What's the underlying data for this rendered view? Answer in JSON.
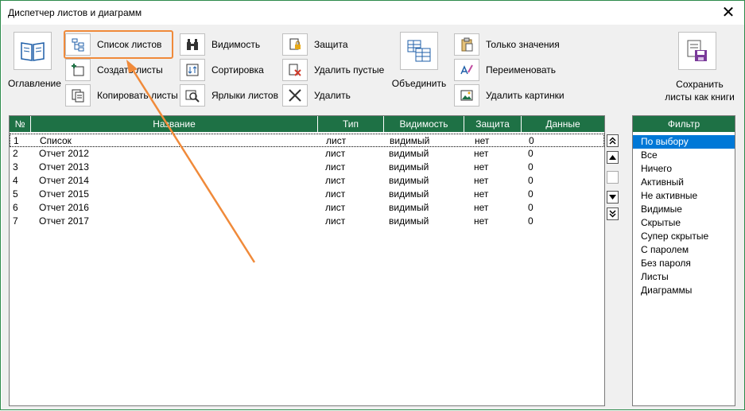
{
  "window": {
    "title": "Диспетчер листов и диаграмм",
    "close_glyph": "✕"
  },
  "toolbar": {
    "contents_label": "Оглавление",
    "sheet_list_label": "Список листов",
    "create_sheets_label": "Создать листы",
    "copy_sheets_label": "Копировать листы",
    "visibility_label": "Видимость",
    "sorting_label": "Сортировка",
    "sheet_tabs_label": "Ярлыки листов",
    "protection_label": "Защита",
    "delete_empty_label": "Удалить пустые",
    "delete_label": "Удалить",
    "merge_label": "Объединить",
    "values_only_label": "Только значения",
    "rename_label": "Переименовать",
    "delete_pictures_label": "Удалить картинки",
    "save_as_books_label_1": "Сохранить",
    "save_as_books_label_2": "листы как книги"
  },
  "grid": {
    "columns": [
      "№",
      "Название",
      "Тип",
      "Видимость",
      "Защита",
      "Данные"
    ],
    "rows": [
      {
        "num": "1",
        "name": "Список",
        "type": "лист",
        "visibility": "видимый",
        "protection": "нет",
        "data": "0"
      },
      {
        "num": "2",
        "name": "Отчет 2012",
        "type": "лист",
        "visibility": "видимый",
        "protection": "нет",
        "data": "0"
      },
      {
        "num": "3",
        "name": "Отчет 2013",
        "type": "лист",
        "visibility": "видимый",
        "protection": "нет",
        "data": "0"
      },
      {
        "num": "4",
        "name": "Отчет 2014",
        "type": "лист",
        "visibility": "видимый",
        "protection": "нет",
        "data": "0"
      },
      {
        "num": "5",
        "name": "Отчет 2015",
        "type": "лист",
        "visibility": "видимый",
        "protection": "нет",
        "data": "0"
      },
      {
        "num": "6",
        "name": "Отчет 2016",
        "type": "лист",
        "visibility": "видимый",
        "protection": "нет",
        "data": "0"
      },
      {
        "num": "7",
        "name": "Отчет 2017",
        "type": "лист",
        "visibility": "видимый",
        "protection": "нет",
        "data": "0"
      }
    ]
  },
  "filter": {
    "title": "Фильтр",
    "selected_index": 0,
    "items": [
      "По выбору",
      "Все",
      "Ничего",
      "Активный",
      "Не активные",
      "Видимые",
      "Скрытые",
      "Супер скрытые",
      "С паролем",
      "Без пароля",
      "Листы",
      "Диаграммы"
    ]
  },
  "annotation": {
    "color": "#f08a3a"
  }
}
